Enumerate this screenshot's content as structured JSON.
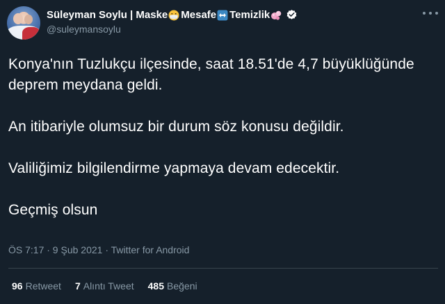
{
  "user": {
    "display_name_part1": "Süleyman Soylu | Maske",
    "display_name_part2": " Mesafe",
    "display_name_part3": " Temizlik",
    "emoji_1": "mask-face-icon",
    "emoji_2": "left-right-arrow-icon",
    "emoji_3": "soap-bubbles-icon",
    "handle": "@suleymansoylu",
    "verified_icon": "verified-badge-icon"
  },
  "tweet": {
    "paragraphs": [
      "Konya'nın Tuzlukçu ilçesinde, saat 18.51'de 4,7 büyüklüğünde deprem meydana geldi.",
      "An itibariyle olumsuz bir durum söz konusu değildir.",
      "Valiliğimiz bilgilendirme yapmaya devam edecektir.",
      "Geçmiş olsun"
    ],
    "meta": "ÖS 7:17 · 9 Şub 2021 · Twitter for Android"
  },
  "stats": {
    "retweets_count": "96",
    "retweets_label": "Retweet",
    "quotes_count": "7",
    "quotes_label": "Alıntı Tweet",
    "likes_count": "485",
    "likes_label": "Beğeni"
  },
  "colors": {
    "background": "#15202b",
    "text": "#ffffff",
    "secondary": "#8899a6",
    "verified": "#ffffff",
    "divider": "#38444d"
  }
}
